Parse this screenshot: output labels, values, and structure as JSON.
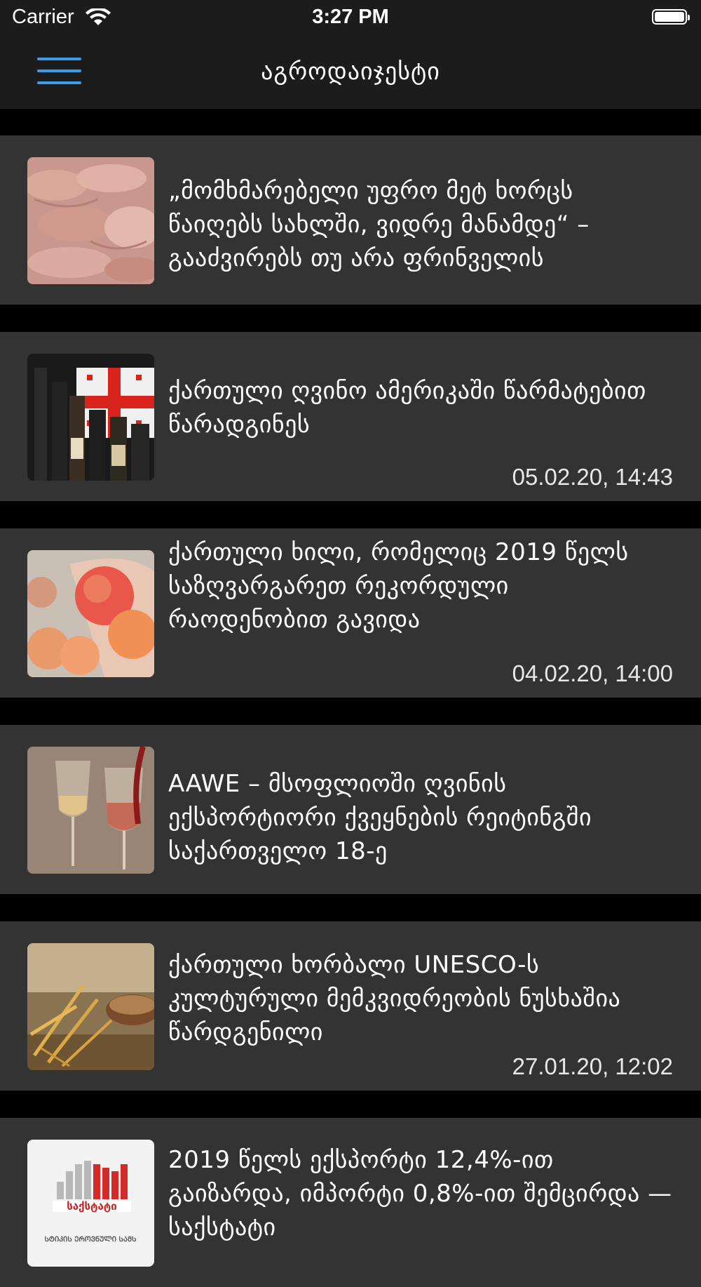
{
  "status": {
    "carrier": "Carrier",
    "time": "3:27 PM"
  },
  "nav": {
    "title": "აგროდაიჯესტი"
  },
  "articles": [
    {
      "title": "„მომხმარებელი უფრო მეტ ხორცს წაიღებს სახლში, ვიდრე მანამდე“ – გააძვირებს თუ არა ფრინველის",
      "date": ""
    },
    {
      "title": "ქართული ღვინო ამერიკაში წარმატებით წარადგინეს",
      "date": "05.02.20, 14:43"
    },
    {
      "title": "ქართული ხილი, რომელიც 2019 წელს საზღვარგარეთ რეკორდული რაოდენობით გავიდა",
      "date": "04.02.20, 14:00"
    },
    {
      "title": "AAWE – მსოფლიოში ღვინის ექსპორტიორი ქვეყნების რეიტინგში საქართველო 18-ე",
      "date": ""
    },
    {
      "title": "ქართული ხორბალი UNESCO-ს კულტურული მემკვიდრეობის ნუსხაშია წარდგენილი",
      "date": "27.01.20, 12:02"
    },
    {
      "title": "2019 წელს ექსპორტი 12,4%-ით გაიზარდა, იმპორტი 0,8%-ით შემცირდა — საქსტატი",
      "date": ""
    }
  ],
  "logo_text": {
    "brand": "საქსტატი",
    "tagline": "ᲡᲢᲘᲙᲘᲡ ᲔᲠᲝᲕᲜᲣᲚᲘ ᲡᲐᲛᲡ"
  }
}
